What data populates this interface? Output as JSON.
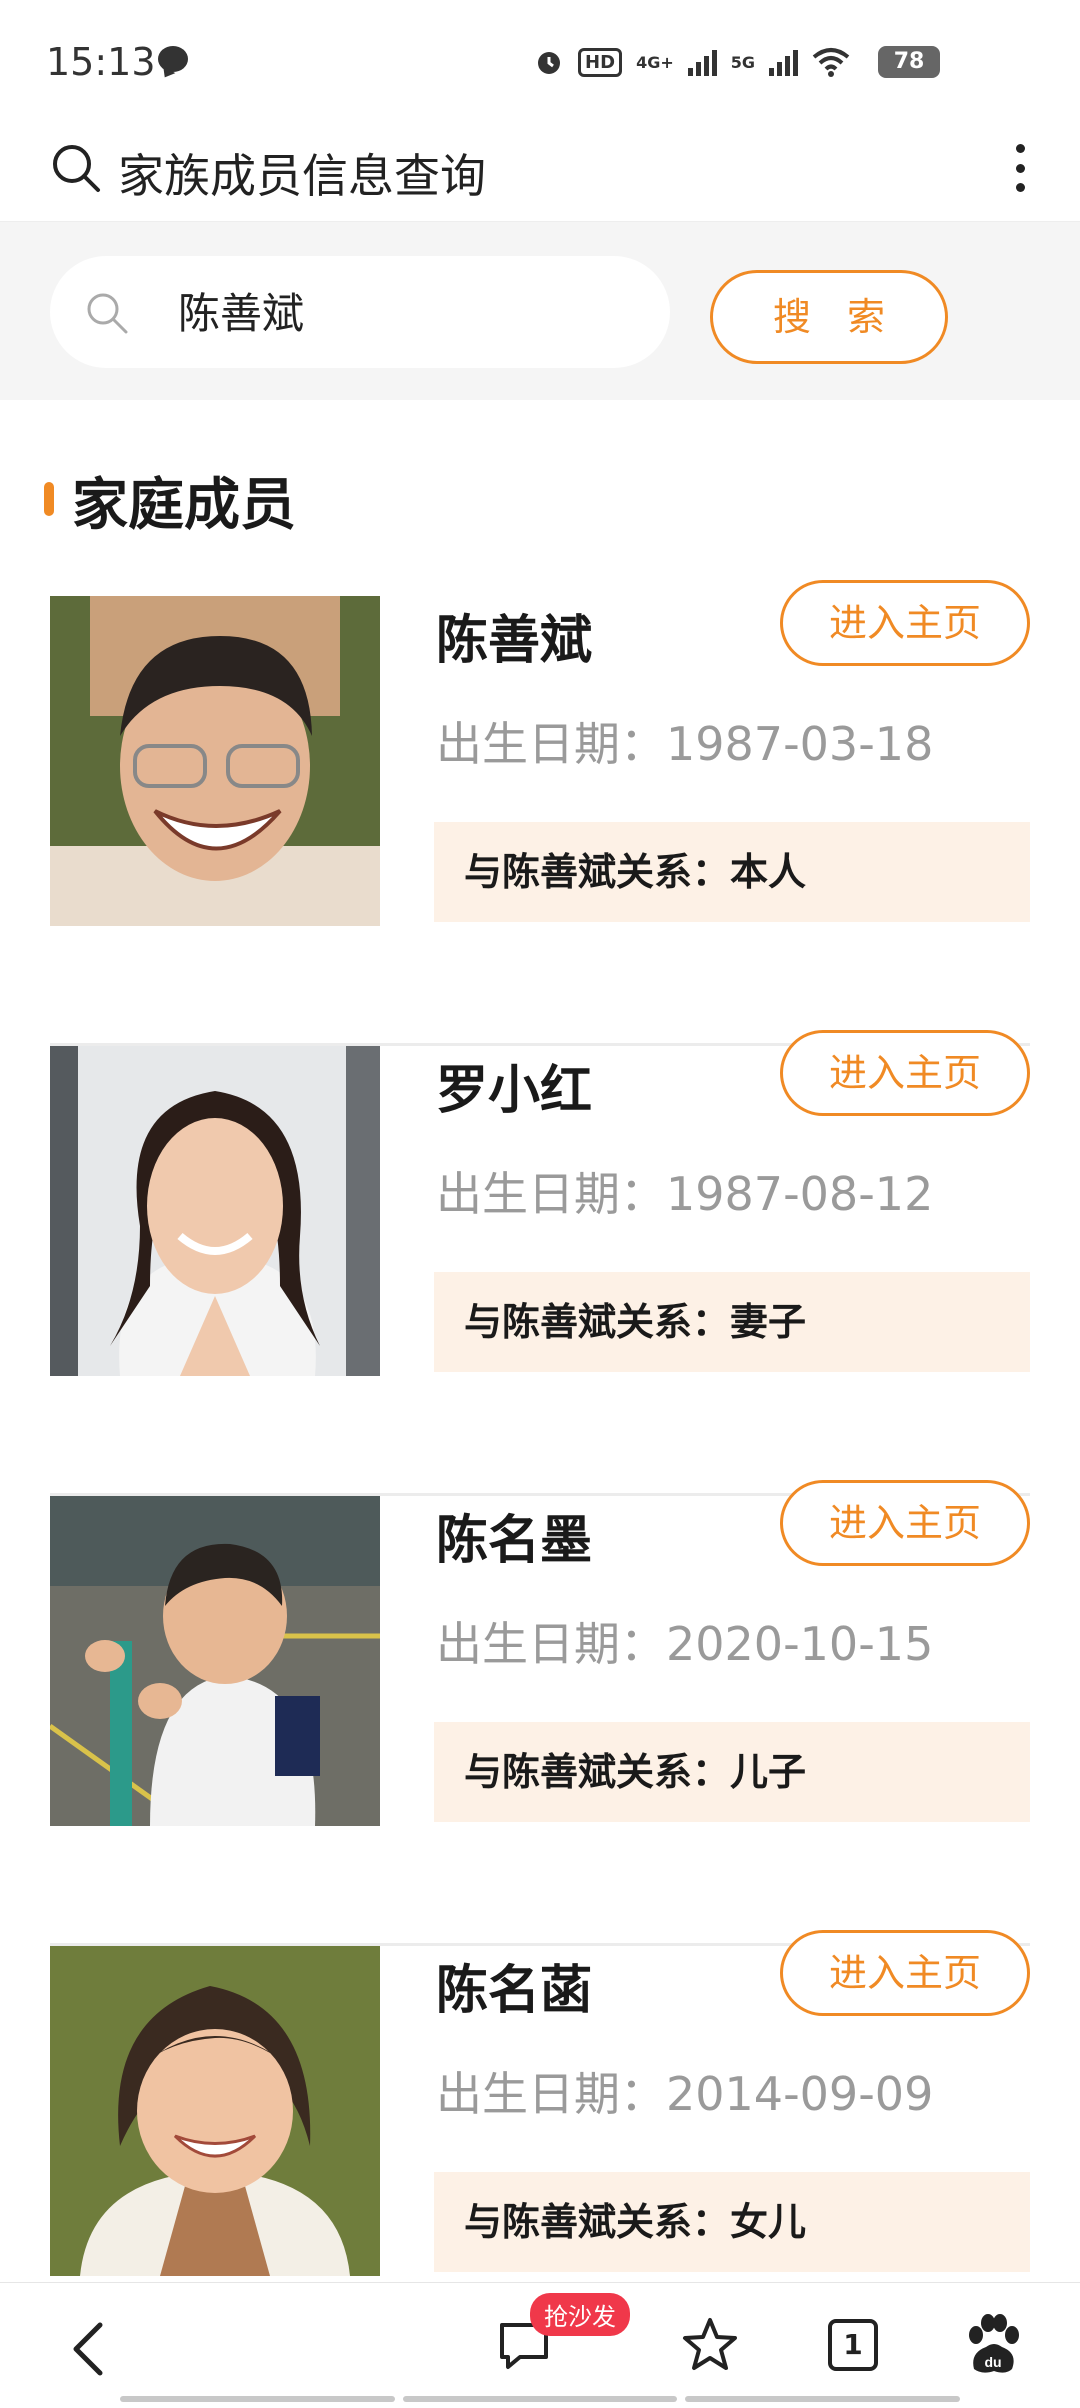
{
  "status_bar": {
    "time": "15:13",
    "hd_label": "HD",
    "network_4g": "4G+",
    "network_5g": "5G",
    "battery": "78"
  },
  "header": {
    "title": "家族成员信息查询"
  },
  "search": {
    "value": "陈善斌",
    "button_label": "搜 索"
  },
  "section": {
    "title": "家庭成员"
  },
  "members": [
    {
      "name": "陈善斌",
      "birth": "出生日期：1987-03-18",
      "relation": "与陈善斌关系：本人",
      "home_label": "进入主页"
    },
    {
      "name": "罗小红",
      "birth": "出生日期：1987-08-12",
      "relation": "与陈善斌关系：妻子",
      "home_label": "进入主页"
    },
    {
      "name": "陈名墨",
      "birth": "出生日期：2020-10-15",
      "relation": "与陈善斌关系：儿子",
      "home_label": "进入主页"
    },
    {
      "name": "陈名菡",
      "birth": "出生日期：2014-09-09",
      "relation": "与陈善斌关系：女儿",
      "home_label": "进入主页"
    }
  ],
  "bottom_nav": {
    "comment_badge": "抢沙发",
    "tab_count": "1"
  },
  "colors": {
    "accent": "#f08a24",
    "relation_bg": "#fdf1e6",
    "badge": "#f0384a"
  }
}
